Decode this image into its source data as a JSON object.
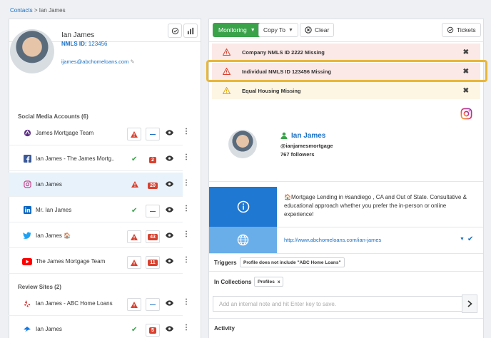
{
  "breadcrumb": {
    "parent": "Contacts",
    "separator": ">",
    "current": "Ian James"
  },
  "profile": {
    "name": "Ian James",
    "nmls_label": "NMLS ID:",
    "nmls_value": "123456",
    "email": "ijames@abchomeloans.com"
  },
  "social": {
    "title": "Social Media Accounts (6)",
    "rows": [
      {
        "icon": "mortgage-logo-icon",
        "label": "James Mortgage Team",
        "status": "warning",
        "badge": ""
      },
      {
        "icon": "facebook-icon",
        "label": "Ian James - The James Mortg...",
        "status": "ok",
        "badge": "2"
      },
      {
        "icon": "instagram-icon",
        "label": "Ian James",
        "status": "warning",
        "badge": "20"
      },
      {
        "icon": "linkedin-icon",
        "label": "Mr. Ian James",
        "status": "ok",
        "badge": ""
      },
      {
        "icon": "twitter-icon",
        "label": "Ian James 🏠",
        "status": "warning",
        "badge": "43"
      },
      {
        "icon": "youtube-icon",
        "label": "The James Mortgage Team",
        "status": "warning",
        "badge": "11"
      }
    ]
  },
  "review": {
    "title": "Review Sites (2)",
    "rows": [
      {
        "icon": "yelp-icon",
        "label": "Ian James - ABC Home Loans",
        "status": "warning",
        "badge": ""
      },
      {
        "icon": "zillow-icon",
        "label": "Ian James",
        "status": "ok",
        "badge": "5"
      }
    ]
  },
  "toolbar": {
    "monitoring": "Monitoring",
    "copy_to": "Copy To",
    "clear": "Clear",
    "tickets": "Tickets"
  },
  "alerts": [
    {
      "text": "Company NMLS ID 2222 Missing",
      "level": "error"
    },
    {
      "text": "Individual NMLS ID 123456 Missing",
      "level": "error"
    },
    {
      "text": "Equal Housing Missing",
      "level": "warning"
    }
  ],
  "detail": {
    "name": "Ian James",
    "handle": "@ianjamesmortgage",
    "followers": "767 followers",
    "bio": "🏠Mortgage Lending in #sandiego , CA and Out of State. Consultative & educational approach whether you prefer the in-person or online experience!",
    "url": "http://www.abchomeloans.com/ian-james",
    "triggers_label": "Triggers",
    "trigger_chip": "Profile does not include \"ABC Home Loans\"",
    "collections_label": "In Collections",
    "collection_chip": "Profiles",
    "collection_chip_x": "x",
    "note_placeholder": "Add an internal note and hit Enter key to save.",
    "activity_label": "Activity"
  },
  "colors": {
    "accent_blue": "#1a6fc1",
    "green": "#3aa34a",
    "red": "#d9412f",
    "highlight": "#e8b739"
  }
}
